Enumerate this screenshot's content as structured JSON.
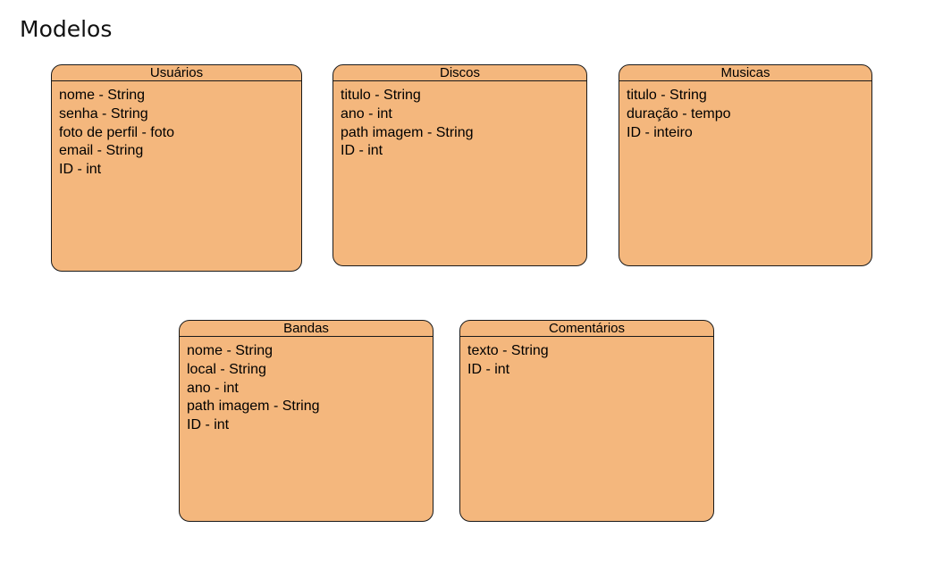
{
  "page": {
    "title": "Modelos"
  },
  "colors": {
    "entity_fill": "#f4b77d",
    "entity_stroke": "#1a1a1a",
    "background": "#ffffff"
  },
  "entities": [
    {
      "name": "Usuários",
      "fields": [
        "nome - String",
        "senha - String",
        "foto de perfil - foto",
        "email - String",
        "ID - int"
      ]
    },
    {
      "name": "Discos",
      "fields": [
        "titulo - String",
        "ano - int",
        "path imagem - String",
        "ID - int"
      ]
    },
    {
      "name": "Musicas",
      "fields": [
        "titulo - String",
        "duração - tempo",
        "ID - inteiro"
      ]
    },
    {
      "name": "Bandas",
      "fields": [
        "nome - String",
        "local - String",
        "ano - int",
        "path imagem - String",
        "ID - int"
      ]
    },
    {
      "name": "Comentários",
      "fields": [
        "texto - String",
        "ID - int"
      ]
    }
  ]
}
